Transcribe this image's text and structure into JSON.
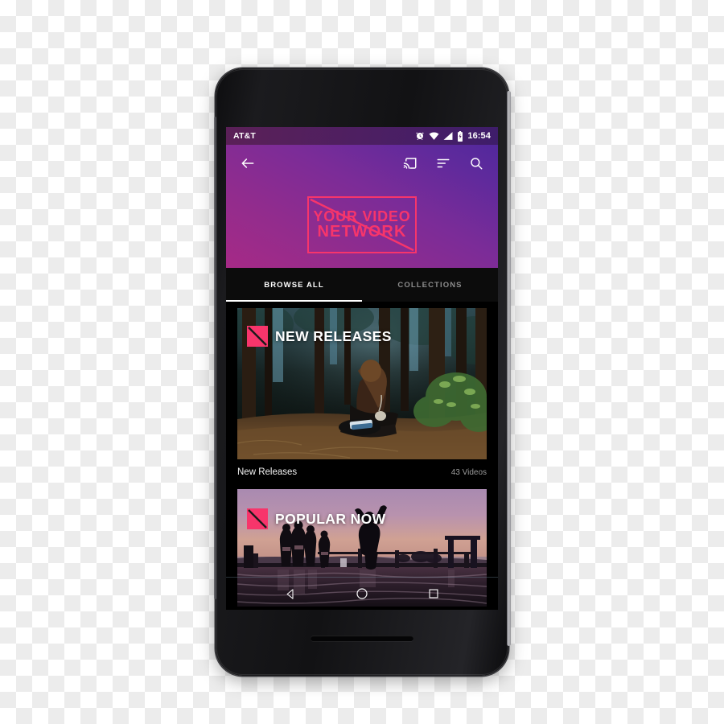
{
  "device": {
    "name": "android-smartphone-mockup",
    "front_camera": "front-camera",
    "earpiece": "earpiece-speaker",
    "bottom_speaker": "bottom-speaker"
  },
  "statusbar": {
    "carrier": "AT&T",
    "time": "16:54",
    "icons": [
      "alarm-icon",
      "wifi-icon",
      "cellular-signal-icon",
      "battery-charging-icon"
    ]
  },
  "appbar": {
    "back_icon": "back-arrow-icon",
    "cast_icon": "cast-icon",
    "sort_icon": "sort-icon",
    "search_icon": "search-icon",
    "logo": {
      "line1": "YOUR VIDEO",
      "line2": "NETWORK",
      "color": "#f7356b"
    }
  },
  "tabs": [
    {
      "label": "BROWSE ALL",
      "active": true
    },
    {
      "label": "COLLECTIONS",
      "active": false
    }
  ],
  "cards": [
    {
      "overlay_title": "NEW RELEASES",
      "title": "New Releases",
      "count": "43 Videos",
      "badge": "brand-mark-icon",
      "image": "woman-sitting-in-autumn-forest"
    },
    {
      "overlay_title": "POPULAR NOW",
      "title": "Popular Now",
      "count": "",
      "badge": "brand-mark-icon",
      "image": "silhouettes-jumping-off-pier-at-dusk"
    }
  ],
  "navbar": {
    "back": "nav-back-triangle-icon",
    "home": "nav-home-circle-icon",
    "recents": "nav-recents-square-icon"
  },
  "colors": {
    "brand_pink": "#f7356b",
    "gradient_start": "#a62a86",
    "gradient_end": "#52289c",
    "screen_bg": "#000000"
  }
}
